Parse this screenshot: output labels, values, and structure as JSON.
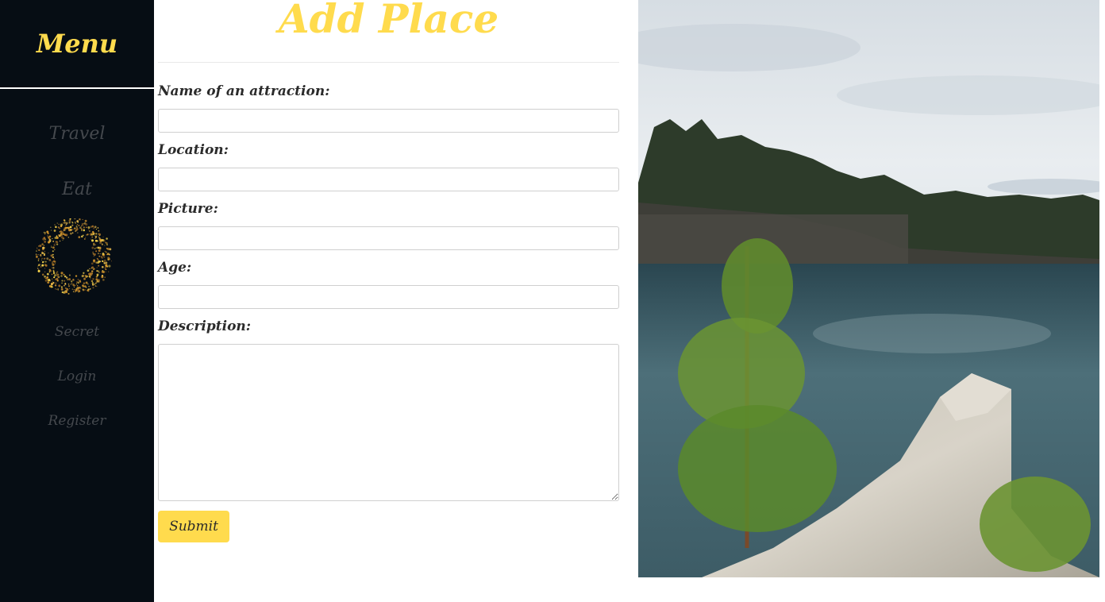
{
  "sidebar": {
    "title": "Menu",
    "items": [
      {
        "label": "Travel"
      },
      {
        "label": "Eat"
      },
      {
        "label": "Secret"
      },
      {
        "label": "Login"
      },
      {
        "label": "Register"
      }
    ]
  },
  "form": {
    "title": "Add Place",
    "fields": [
      {
        "label": "Name of an attraction:",
        "value": ""
      },
      {
        "label": "Location:",
        "value": ""
      },
      {
        "label": "Picture:",
        "value": ""
      },
      {
        "label": "Age:",
        "value": ""
      },
      {
        "label": "Description:",
        "value": ""
      }
    ],
    "submit_label": "Submit"
  },
  "colors": {
    "accent": "#ffdb4d",
    "sidebar_bg": "#060d14",
    "nav_text": "#44484d"
  },
  "icons": {
    "sparkle": "sparkle-ring-icon"
  }
}
